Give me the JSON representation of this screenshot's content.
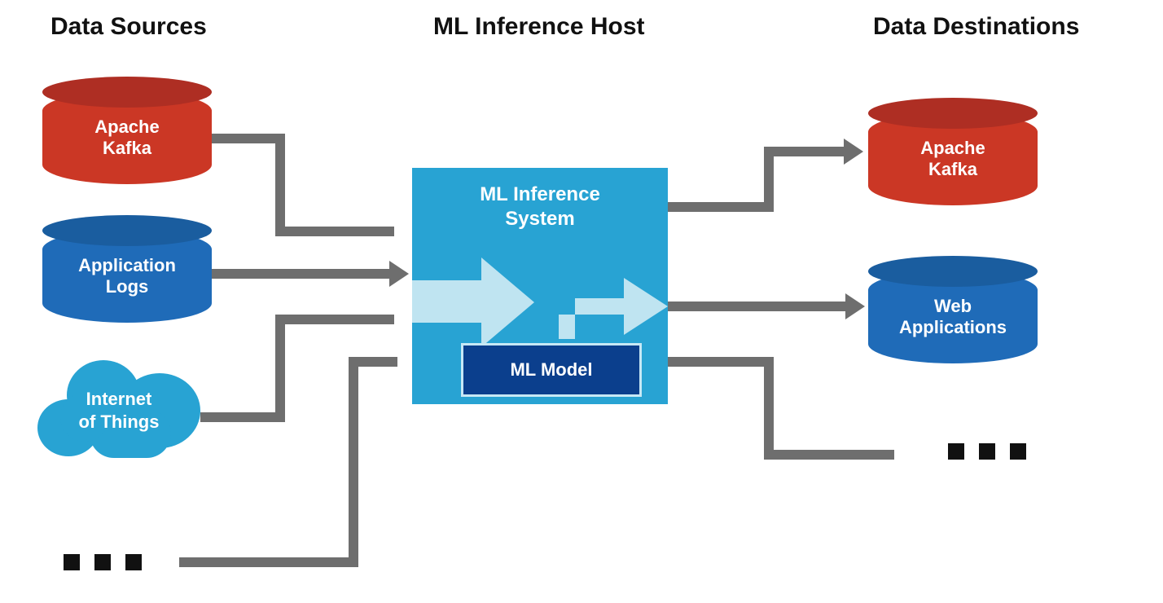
{
  "headings": {
    "sources": "Data Sources",
    "host": "ML Inference Host",
    "destinations": "Data Destinations"
  },
  "sources": [
    {
      "id": "kafka",
      "label": "Apache\nKafka",
      "shape": "cylinder",
      "color": "#cb3725"
    },
    {
      "id": "logs",
      "label": "Application\nLogs",
      "shape": "cylinder",
      "color": "#1f6bb8"
    },
    {
      "id": "iot",
      "label": "Internet\nof Things",
      "shape": "cloud",
      "color": "#28a3d3"
    },
    {
      "id": "more",
      "label": "...",
      "shape": "ellipsis"
    }
  ],
  "inference_host": {
    "title": "ML Inference\nSystem",
    "model_label": "ML Model",
    "box_color": "#28a3d3",
    "model_color": "#0b3f8d"
  },
  "destinations": [
    {
      "id": "kafka",
      "label": "Apache\nKafka",
      "shape": "cylinder",
      "color": "#cb3725"
    },
    {
      "id": "web",
      "label": "Web\nApplications",
      "shape": "cylinder",
      "color": "#1f6bb8"
    },
    {
      "id": "more",
      "label": "...",
      "shape": "ellipsis"
    }
  ],
  "flows": {
    "description": "Data flows from each source into the ML Inference System, which invokes the ML Model, then results flow out to each destination.",
    "edges": [
      {
        "from": "sources.kafka",
        "to": "inference_host"
      },
      {
        "from": "sources.logs",
        "to": "inference_host"
      },
      {
        "from": "sources.iot",
        "to": "inference_host"
      },
      {
        "from": "sources.more",
        "to": "inference_host"
      },
      {
        "from": "inference_host",
        "to": "inference_host.model",
        "style": "internal"
      },
      {
        "from": "inference_host.model",
        "to": "inference_host.output",
        "style": "internal"
      },
      {
        "from": "inference_host",
        "to": "destinations.kafka"
      },
      {
        "from": "inference_host",
        "to": "destinations.web"
      },
      {
        "from": "inference_host",
        "to": "destinations.more"
      }
    ]
  },
  "colors": {
    "red": "#cb3725",
    "red_dark": "#ae2e23",
    "blue": "#1f6bb8",
    "blue_dark": "#1a5d9f",
    "cyan": "#28a3d3",
    "navy": "#0b3f8d",
    "grey_line": "#6e6e6e",
    "light_arrow": "#bfe4f1"
  }
}
